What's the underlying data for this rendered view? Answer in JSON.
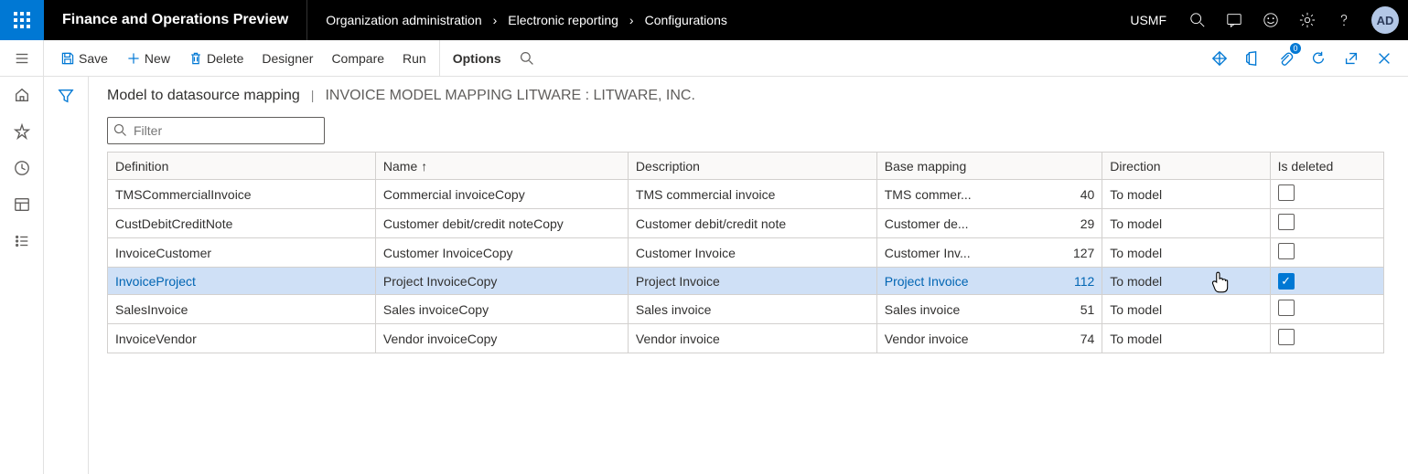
{
  "header": {
    "app_title": "Finance and Operations Preview",
    "breadcrumbs": [
      "Organization administration",
      "Electronic reporting",
      "Configurations"
    ],
    "company": "USMF",
    "avatar": "AD"
  },
  "actions": {
    "save": "Save",
    "new": "New",
    "delete": "Delete",
    "designer": "Designer",
    "compare": "Compare",
    "run": "Run",
    "options": "Options"
  },
  "page": {
    "title": "Model to datasource mapping",
    "separator": "|",
    "subtitle": "INVOICE MODEL MAPPING LITWARE : LITWARE, INC.",
    "filter_placeholder": "Filter"
  },
  "grid": {
    "columns": {
      "definition": "Definition",
      "name": "Name",
      "description": "Description",
      "base_mapping": "Base mapping",
      "direction": "Direction",
      "is_deleted": "Is deleted"
    },
    "rows": [
      {
        "definition": "TMSCommercialInvoice",
        "name": "Commercial invoiceCopy",
        "description": "TMS commercial invoice",
        "base_mapping": "TMS commer...",
        "base_num": "40",
        "direction": "To model",
        "is_deleted": false,
        "selected": false
      },
      {
        "definition": "CustDebitCreditNote",
        "name": "Customer debit/credit noteCopy",
        "description": "Customer debit/credit note",
        "base_mapping": "Customer de...",
        "base_num": "29",
        "direction": "To model",
        "is_deleted": false,
        "selected": false
      },
      {
        "definition": "InvoiceCustomer",
        "name": "Customer InvoiceCopy",
        "description": "Customer Invoice",
        "base_mapping": "Customer Inv...",
        "base_num": "127",
        "direction": "To model",
        "is_deleted": false,
        "selected": false
      },
      {
        "definition": "InvoiceProject",
        "name": "Project InvoiceCopy",
        "description": "Project Invoice",
        "base_mapping": "Project Invoice",
        "base_num": "112",
        "direction": "To model",
        "is_deleted": true,
        "selected": true
      },
      {
        "definition": "SalesInvoice",
        "name": "Sales invoiceCopy",
        "description": "Sales invoice",
        "base_mapping": "Sales invoice",
        "base_num": "51",
        "direction": "To model",
        "is_deleted": false,
        "selected": false
      },
      {
        "definition": "InvoiceVendor",
        "name": "Vendor invoiceCopy",
        "description": "Vendor invoice",
        "base_mapping": "Vendor invoice",
        "base_num": "74",
        "direction": "To model",
        "is_deleted": false,
        "selected": false
      }
    ]
  }
}
